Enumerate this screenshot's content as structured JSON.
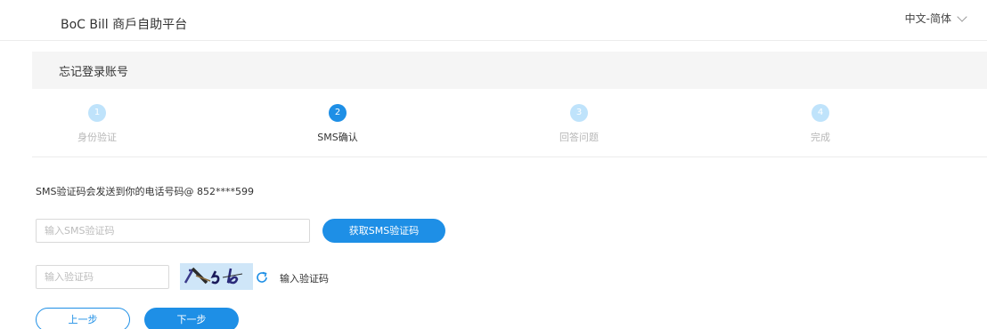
{
  "header": {
    "brand": "BoC Bill 商戶自助平台",
    "language": "中文-简体"
  },
  "page": {
    "title": "忘记登录账号"
  },
  "steps": [
    {
      "number": "1",
      "label": "身份验证",
      "active": false
    },
    {
      "number": "2",
      "label": "SMS确认",
      "active": true
    },
    {
      "number": "3",
      "label": "回答问题",
      "active": false
    },
    {
      "number": "4",
      "label": "完成",
      "active": false
    }
  ],
  "form": {
    "info": "SMS验证码会发送到你的电话号码@ 852****599",
    "sms_placeholder": "输入SMS验证码",
    "get_sms_label": "获取SMS验证码",
    "captcha_placeholder": "输入验证码",
    "captcha_label": "输入验证码",
    "prev_label": "上一步",
    "next_label": "下一步"
  },
  "colors": {
    "primary": "#1e8fe6",
    "step_inactive": "#bfe3fb",
    "captcha_bg": "#cfe6f8"
  },
  "icons": {
    "language_dropdown": "chevron-down-icon",
    "captcha_refresh": "refresh-icon"
  }
}
